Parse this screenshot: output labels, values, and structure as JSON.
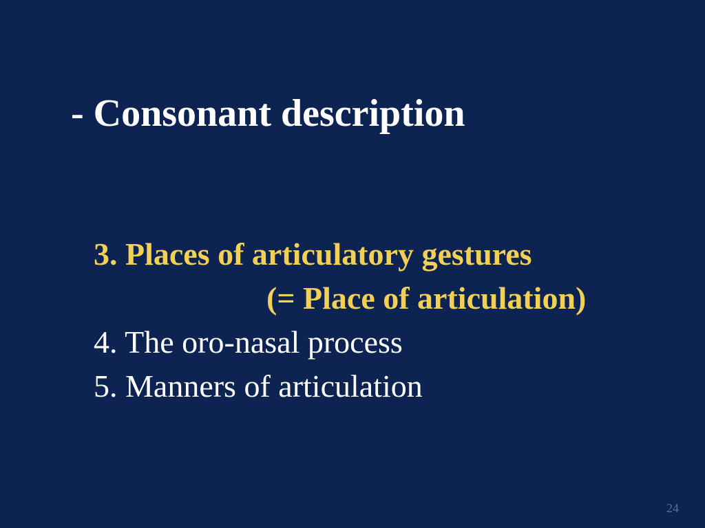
{
  "slide": {
    "title": "- Consonant description",
    "items": [
      {
        "line1": "3. Places of articulatory gestures",
        "line2": "(= Place of articulation)",
        "highlighted": true
      },
      {
        "line1": "4. The oro-nasal process",
        "highlighted": false
      },
      {
        "line1": "5. Manners of articulation",
        "highlighted": false
      }
    ],
    "page_number": "24"
  },
  "colors": {
    "background": "#0d2352",
    "title_text": "#ffffff",
    "highlight_text": "#f2cf55",
    "body_text": "#ffffff",
    "page_number": "#5f6f8f"
  }
}
